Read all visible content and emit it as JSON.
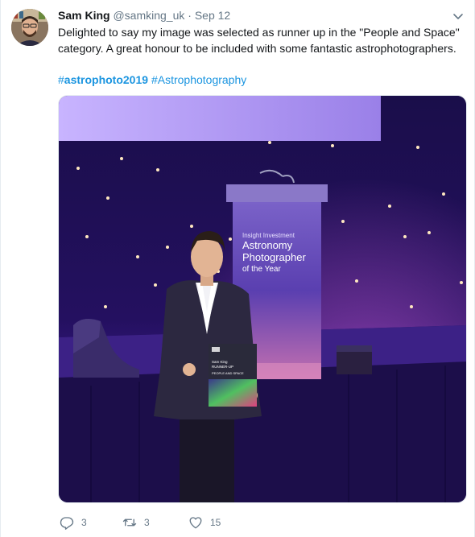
{
  "tweet": {
    "author_name": "Sam King",
    "handle": "@samking_uk",
    "separator": "·",
    "date": "Sep 12",
    "text": "Delighted to say my image was selected as runner up in the \"People and Space\" category. A great honour to be included with some fantastic astrophotographers.",
    "hashtags": [
      {
        "hash": "#",
        "word": "astrophoto2019"
      },
      {
        "hash": "#",
        "word": "Astrophotography"
      }
    ],
    "photo": {
      "podium_line1": "Insight Investment",
      "podium_line2": "Astronomy",
      "podium_line3": "Photographer",
      "podium_line4": "of the Year",
      "certificate_name": "Sam King",
      "certificate_award": "RUNNER-UP",
      "certificate_category": "PEOPLE AND SPACE"
    },
    "actions": {
      "replies": "3",
      "retweets": "3",
      "likes": "15"
    }
  },
  "icons": {
    "reply": "reply-icon",
    "retweet": "retweet-icon",
    "like": "heart-icon",
    "caret": "chevron-down-icon"
  },
  "colors": {
    "link": "#1b95e0",
    "muted": "#657786",
    "text": "#14171a",
    "stage_purple": "#3a1a8a"
  }
}
